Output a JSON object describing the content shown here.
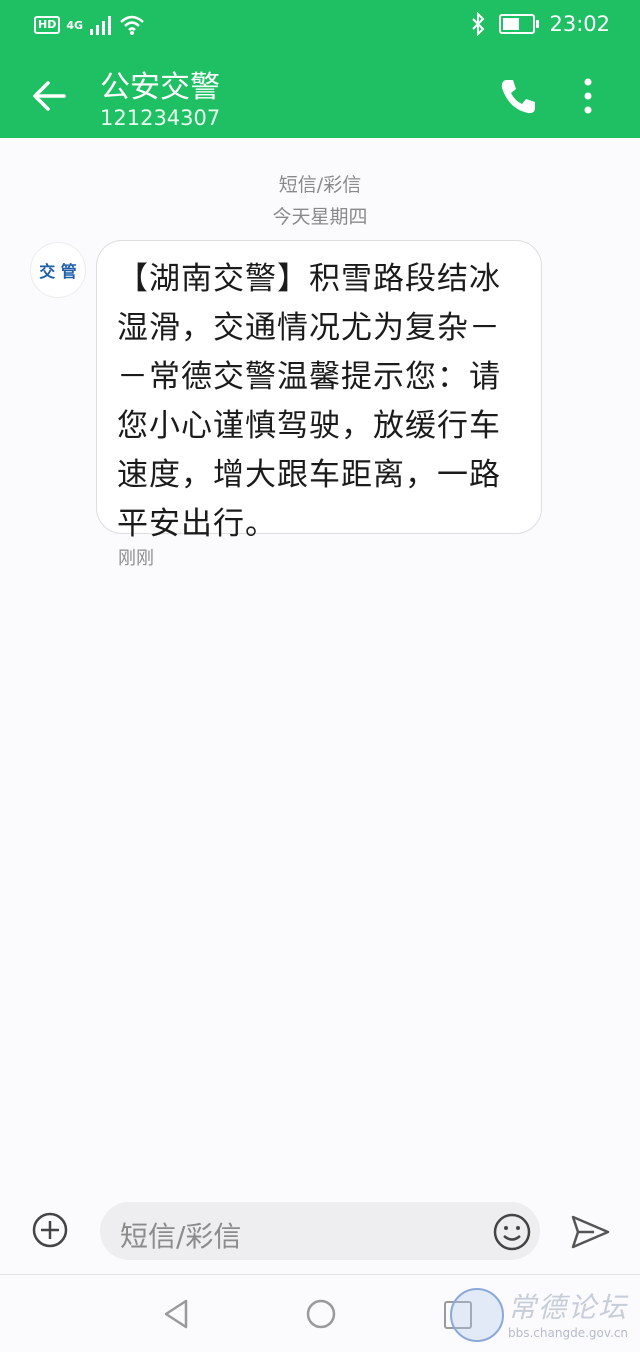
{
  "status_bar": {
    "hd_label": "HD",
    "network_label": "4G",
    "time": "23:02",
    "battery_level_percent": 55,
    "icons": [
      "signal-icon",
      "wifi-icon",
      "bluetooth-icon",
      "battery-icon"
    ]
  },
  "header": {
    "title": "公安交警",
    "number": "121234307",
    "background_color": "#1fc063",
    "icons": [
      "back-arrow-icon",
      "phone-icon",
      "more-vert-icon"
    ]
  },
  "conversation": {
    "channel_label": "短信/彩信",
    "date_label": "今天星期四",
    "sender_avatar_text": "交 管",
    "message_text": "【湖南交警】积雪路段结冰湿滑，交通情况尤为复杂－－常德交警温馨提示您：请您小心谨慎驾驶，放缓行车速度，增大跟车距离，一路平安出行。",
    "message_time": "刚刚"
  },
  "composer": {
    "placeholder": "短信/彩信",
    "icons": [
      "add-circle-icon",
      "emoji-icon",
      "send-icon"
    ]
  },
  "nav_bar": {
    "icons": [
      "nav-back-icon",
      "nav-home-icon",
      "nav-recents-icon"
    ]
  },
  "watermark": {
    "title": "常德论坛",
    "url": "bbs.changde.gov.cn"
  }
}
